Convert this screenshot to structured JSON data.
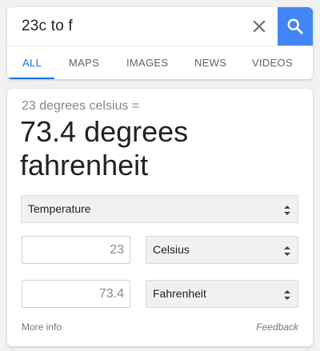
{
  "search": {
    "query": "23c to f",
    "clear_icon": "close-icon",
    "search_icon": "magnifier-icon",
    "accent_color": "#4285f4"
  },
  "tabs": [
    {
      "label": "ALL",
      "active": true
    },
    {
      "label": "MAPS",
      "active": false
    },
    {
      "label": "IMAGES",
      "active": false
    },
    {
      "label": "NEWS",
      "active": false
    },
    {
      "label": "VIDEOS",
      "active": false
    }
  ],
  "converter": {
    "input_summary": "23 degrees celsius =",
    "result": "73.4 degrees fahrenheit",
    "category": "Temperature",
    "from": {
      "value": "23",
      "unit": "Celsius"
    },
    "to": {
      "value": "73.4",
      "unit": "Fahrenheit"
    },
    "more_info": "More info",
    "feedback": "Feedback"
  }
}
